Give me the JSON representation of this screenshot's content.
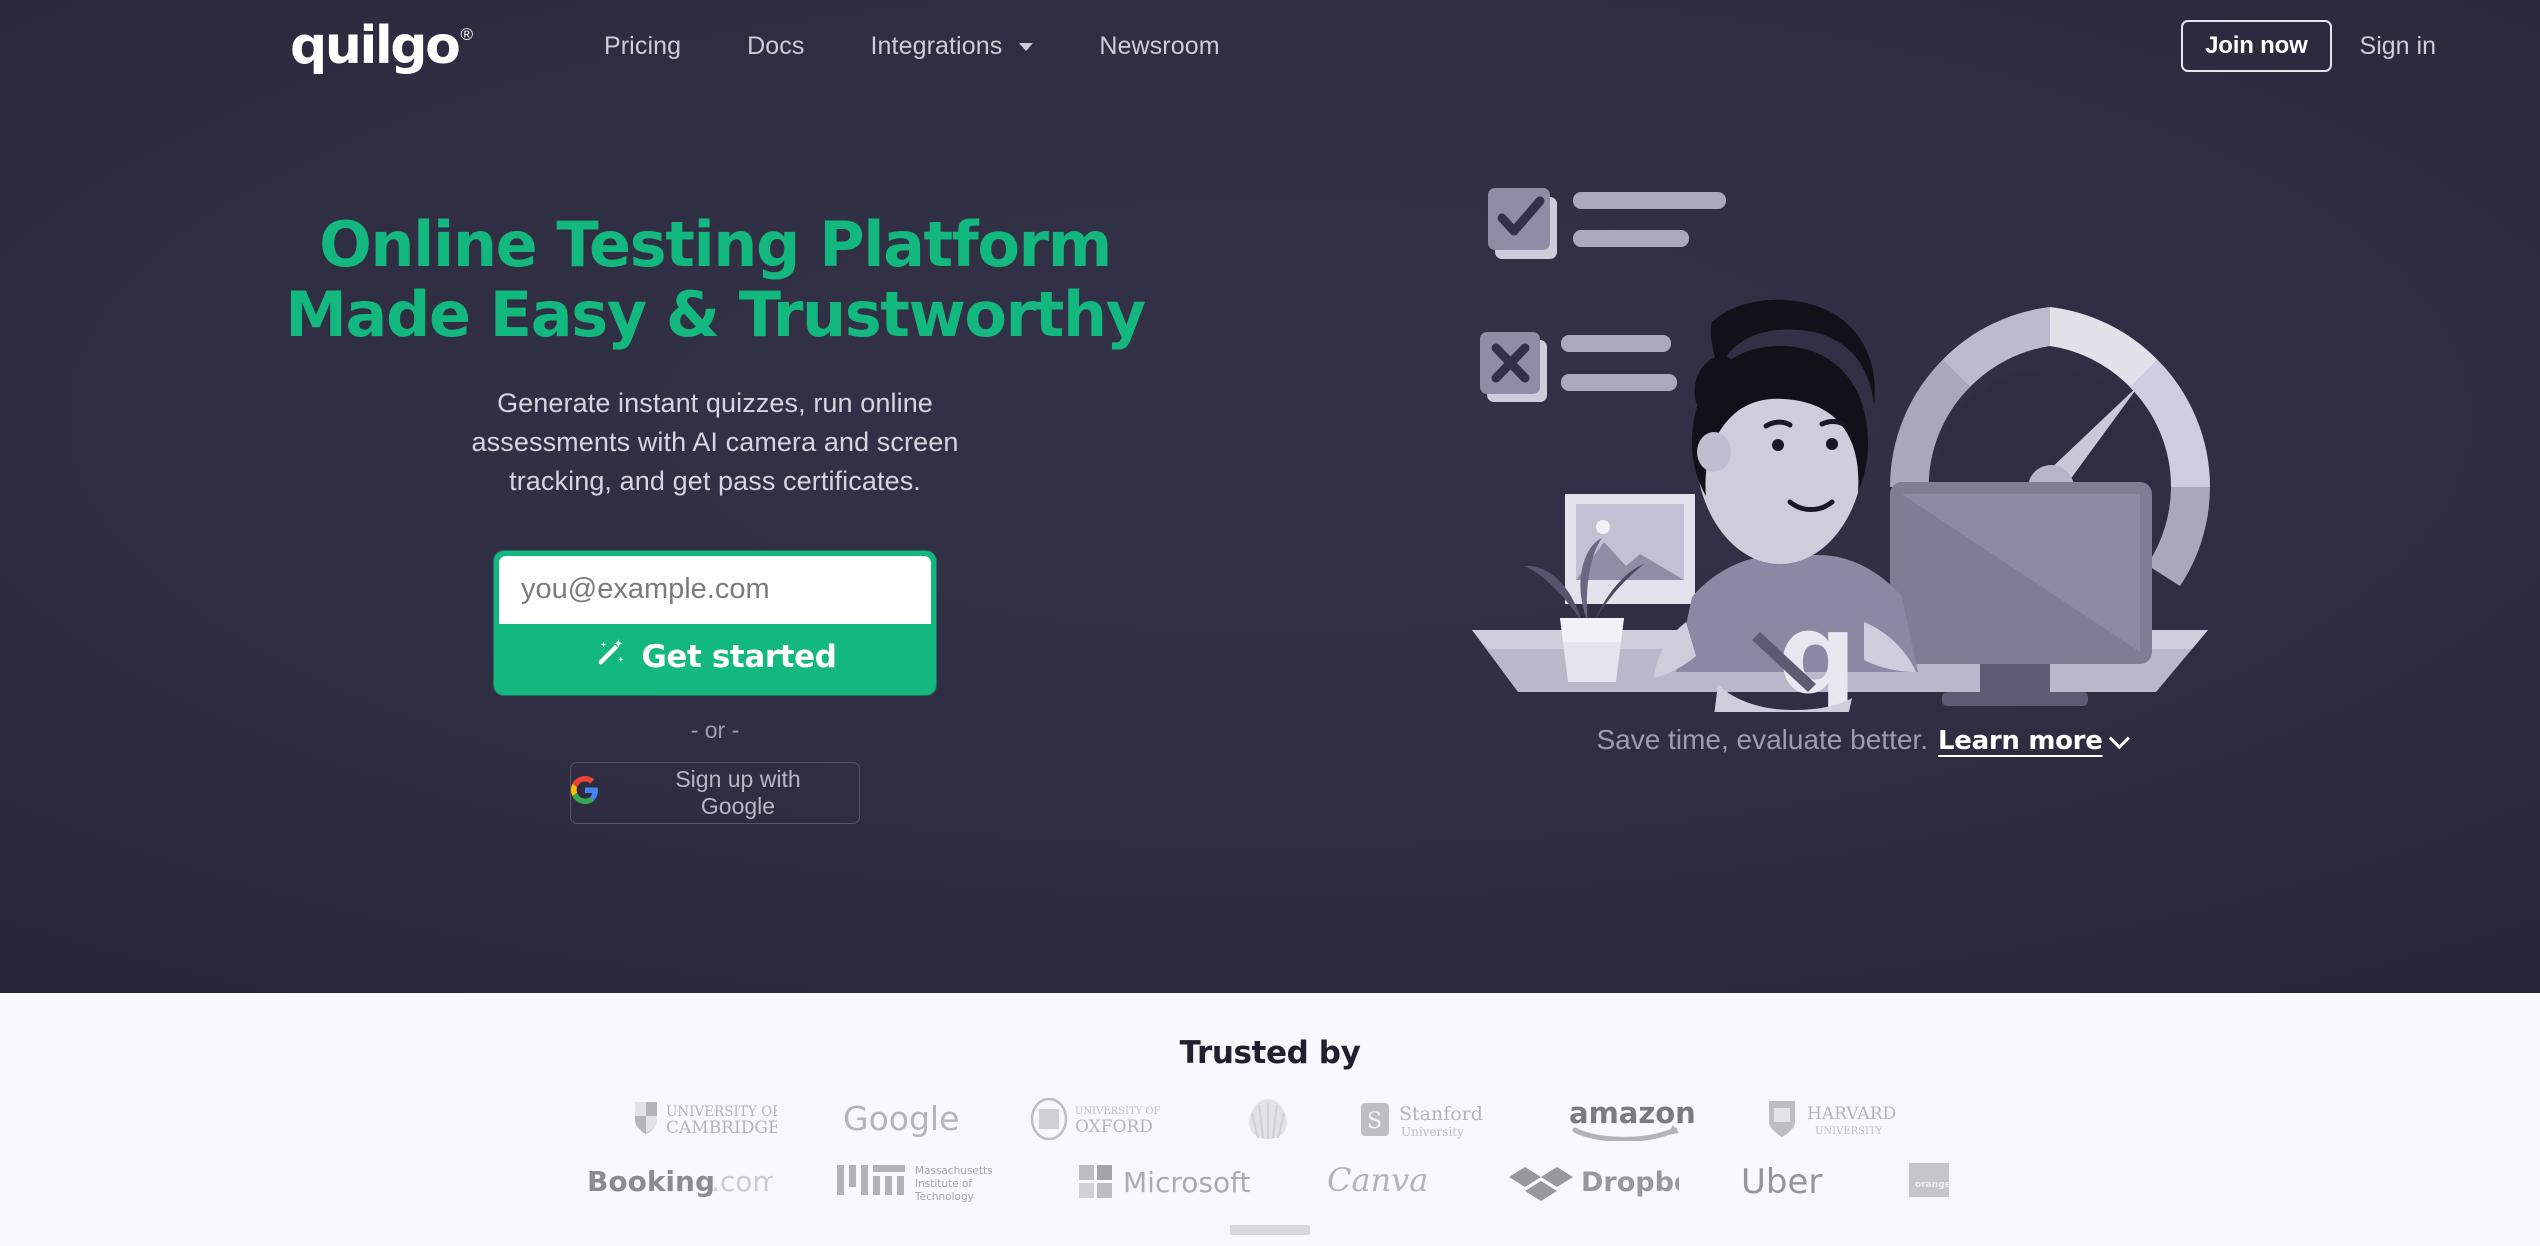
{
  "brand": {
    "name": "quilgo",
    "registered": "®"
  },
  "nav": {
    "links": [
      {
        "label": "Pricing",
        "dropdown": false
      },
      {
        "label": "Docs",
        "dropdown": false
      },
      {
        "label": "Integrations",
        "dropdown": true
      },
      {
        "label": "Newsroom",
        "dropdown": false
      }
    ],
    "join_label": "Join now",
    "signin_label": "Sign in"
  },
  "hero": {
    "headline_line1": "Online Testing Platform",
    "headline_line2": "Made Easy & Trustworthy",
    "subheadline": "Generate instant quizzes, run online assessments with AI camera and screen tracking, and get pass certificates.",
    "email_placeholder": "you@example.com",
    "email_value": "",
    "get_started_label": "Get started",
    "or_label": "- or -",
    "google_label": "Sign up with Google",
    "tagline_text": "Save time, evaluate better.",
    "learn_more_label": "Learn more",
    "illustration_shirt_letter": "q"
  },
  "trusted": {
    "title": "Trusted by",
    "row1": [
      {
        "name": "University of Cambridge",
        "line1": "UNIVERSITY OF",
        "line2": "CAMBRIDGE"
      },
      {
        "name": "Google",
        "line1": "Google",
        "line2": ""
      },
      {
        "name": "University of Oxford",
        "line1": "UNIVERSITY OF",
        "line2": "OXFORD"
      },
      {
        "name": "Shell",
        "line1": "",
        "line2": ""
      },
      {
        "name": "Stanford University",
        "line1": "Stanford",
        "line2": "University"
      },
      {
        "name": "amazon",
        "line1": "amazon",
        "line2": ""
      },
      {
        "name": "Harvard University",
        "line1": "HARVARD",
        "line2": "UNIVERSITY"
      }
    ],
    "row2": [
      {
        "name": "Booking.com",
        "line1": "Booking",
        "line2": ".com"
      },
      {
        "name": "Massachusetts Institute of Technology",
        "line1": "Massachusetts",
        "line2": "Institute of",
        "line3": "Technology"
      },
      {
        "name": "Microsoft",
        "line1": "Microsoft",
        "line2": ""
      },
      {
        "name": "Canva",
        "line1": "Canva",
        "line2": ""
      },
      {
        "name": "Dropbox",
        "line1": "Dropbox",
        "line2": ""
      },
      {
        "name": "Uber",
        "line1": "Uber",
        "line2": ""
      },
      {
        "name": "Orange",
        "line1": "orange",
        "line2": ""
      }
    ]
  },
  "colors": {
    "accent_green": "#12b87e",
    "hero_bg_center": "#343248",
    "hero_bg_edge": "#222031",
    "light_bg": "#f6f8fc",
    "nav_text": "#cfccd8"
  }
}
